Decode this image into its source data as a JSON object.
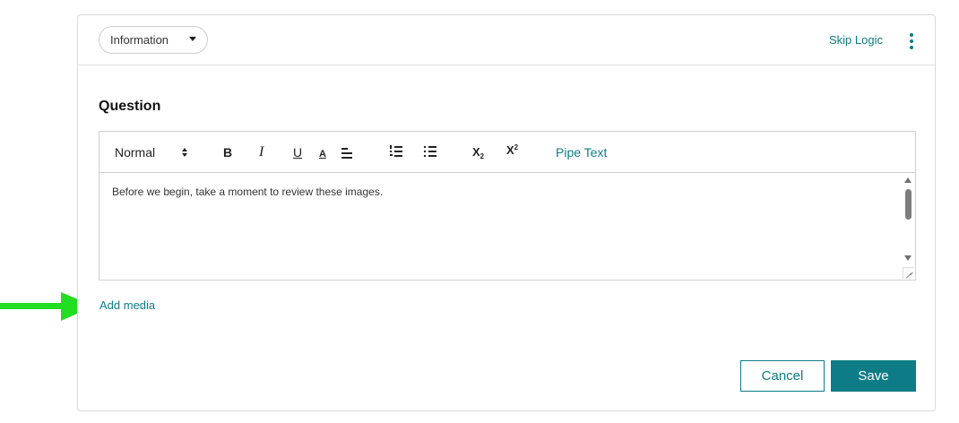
{
  "header": {
    "question_type": "Information",
    "skip_logic_label": "Skip Logic",
    "more_icon": "kebab-vertical-icon"
  },
  "question": {
    "label": "Question",
    "body_text": "Before we begin, take a moment to review these images."
  },
  "toolbar": {
    "format_value": "Normal",
    "bold_label": "B",
    "italic_label": "I",
    "underline_label": "U",
    "text_color_label": "A",
    "subscript_label": "X",
    "subscript_mark": "2",
    "superscript_label": "X",
    "superscript_mark": "2",
    "pipe_text_label": "Pipe Text"
  },
  "add_media_label": "Add media",
  "actions": {
    "cancel_label": "Cancel",
    "save_label": "Save"
  },
  "colors": {
    "accent": "#0e7c86",
    "annotation_arrow": "#22dd22"
  }
}
